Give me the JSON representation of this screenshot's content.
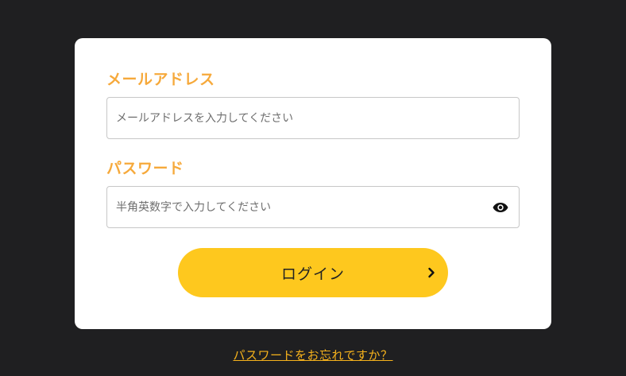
{
  "login_form": {
    "email_label": "メールアドレス",
    "email_placeholder": "メールアドレスを入力してください",
    "email_value": "",
    "password_label": "パスワード",
    "password_placeholder": "半角英数字で入力してください",
    "password_value": "",
    "password_toggle_icon": "eye-icon",
    "login_button_label": "ログイン",
    "login_button_icon": "chevron-right-icon"
  },
  "forgot_password_link": "パスワードをお忘れですか？",
  "colors": {
    "background": "#1f1f21",
    "card": "#ffffff",
    "label_accent": "#f6a93b",
    "button": "#fec81e",
    "link": "#f6b21c"
  }
}
